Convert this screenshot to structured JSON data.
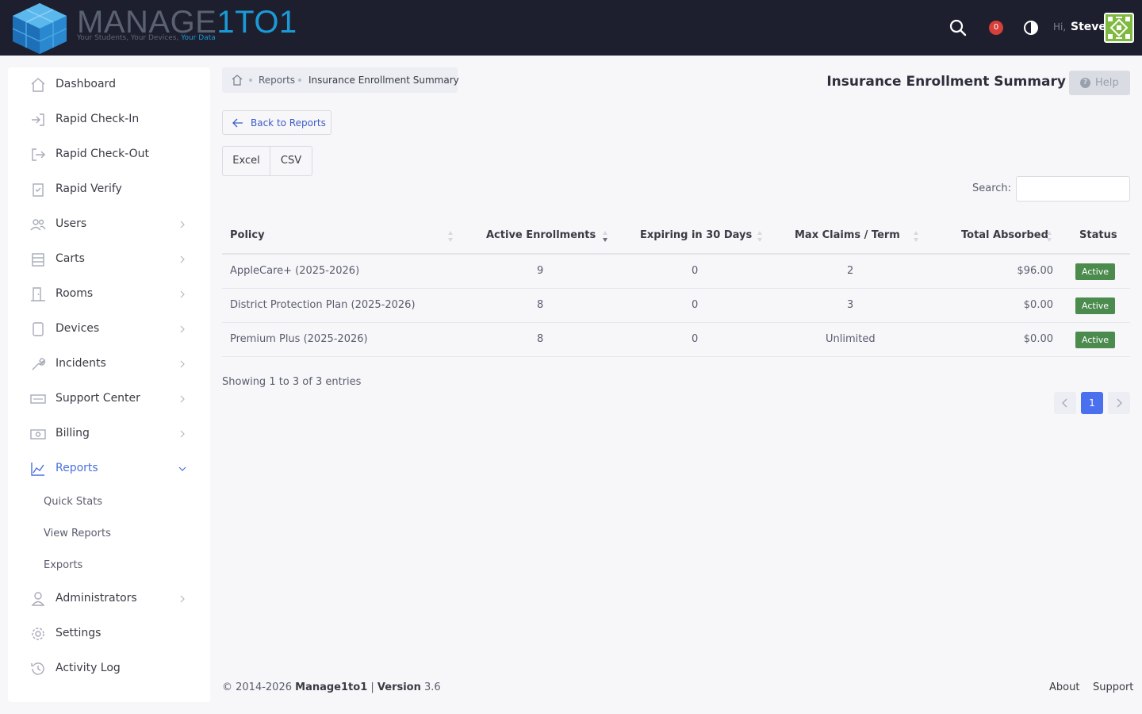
{
  "header": {
    "logo_word1": "MANAGE",
    "logo_word2": "1TO1",
    "tagline_main": "Your Students, Your Devices, ",
    "tagline_accent": "Your Data",
    "notification_count": "0",
    "greeting": "Hi,",
    "user_name": "Steve",
    "icons": [
      "search-icon",
      "notification-badge",
      "theme-toggle-icon",
      "avatar"
    ]
  },
  "sidebar": {
    "items": [
      {
        "label": "Dashboard",
        "icon": "home-icon"
      },
      {
        "label": "Rapid Check-In",
        "icon": "login-icon"
      },
      {
        "label": "Rapid Check-Out",
        "icon": "logout-icon"
      },
      {
        "label": "Rapid Verify",
        "icon": "clipboard-check-icon"
      },
      {
        "label": "Users",
        "icon": "users-icon"
      },
      {
        "label": "Carts",
        "icon": "cart-icon"
      },
      {
        "label": "Rooms",
        "icon": "door-icon"
      },
      {
        "label": "Devices",
        "icon": "tablet-icon"
      },
      {
        "label": "Incidents",
        "icon": "wrench-icon"
      },
      {
        "label": "Support Center",
        "icon": "ticket-icon"
      },
      {
        "label": "Billing",
        "icon": "cash-icon"
      },
      {
        "label": "Reports",
        "icon": "chart-icon"
      },
      {
        "label": "Administrators",
        "icon": "admin-icon"
      },
      {
        "label": "Settings",
        "icon": "gear-icon"
      },
      {
        "label": "Activity Log",
        "icon": "history-icon"
      }
    ],
    "reports_sub": [
      "Quick Stats",
      "View Reports",
      "Exports"
    ]
  },
  "breadcrumb": {
    "link": "Reports",
    "current": "Insurance Enrollment Summary"
  },
  "page": {
    "title": "Insurance Enrollment Summary",
    "help_label": "Help",
    "back_label": "Back to Reports",
    "export_buttons": [
      "Excel",
      "CSV"
    ],
    "search_label": "Search:",
    "search_value": ""
  },
  "table": {
    "columns": [
      "Policy",
      "Active Enrollments",
      "Expiring in 30 Days",
      "Max Claims / Term",
      "Total Absorbed",
      "Status"
    ],
    "sorted_column": "Active Enrollments",
    "sort_direction": "descending",
    "rows": [
      {
        "policy": "AppleCare+ (2025-2026)",
        "active": "9",
        "expiring": "0",
        "max_claims": "2",
        "absorbed": "$96.00",
        "status": "Active"
      },
      {
        "policy": "District Protection Plan (2025-2026)",
        "active": "8",
        "expiring": "0",
        "max_claims": "3",
        "absorbed": "$0.00",
        "status": "Active"
      },
      {
        "policy": "Premium Plus (2025-2026)",
        "active": "8",
        "expiring": "0",
        "max_claims": "Unlimited",
        "absorbed": "$0.00",
        "status": "Active"
      }
    ],
    "info": "Showing 1 to 3 of 3 entries",
    "current_page": "1"
  },
  "footer": {
    "copyright": "© 2014-2026",
    "brand": "Manage1to1",
    "separator": " | ",
    "version_label": "Version",
    "version_value": "3.6",
    "links": [
      "About",
      "Support"
    ]
  },
  "colors": {
    "topbar": "#1e1f2e",
    "brand_blue": "#1a9ad6",
    "accent": "#4a70f0",
    "status_active": "#4c8b4e",
    "notification": "#d63f3a"
  }
}
